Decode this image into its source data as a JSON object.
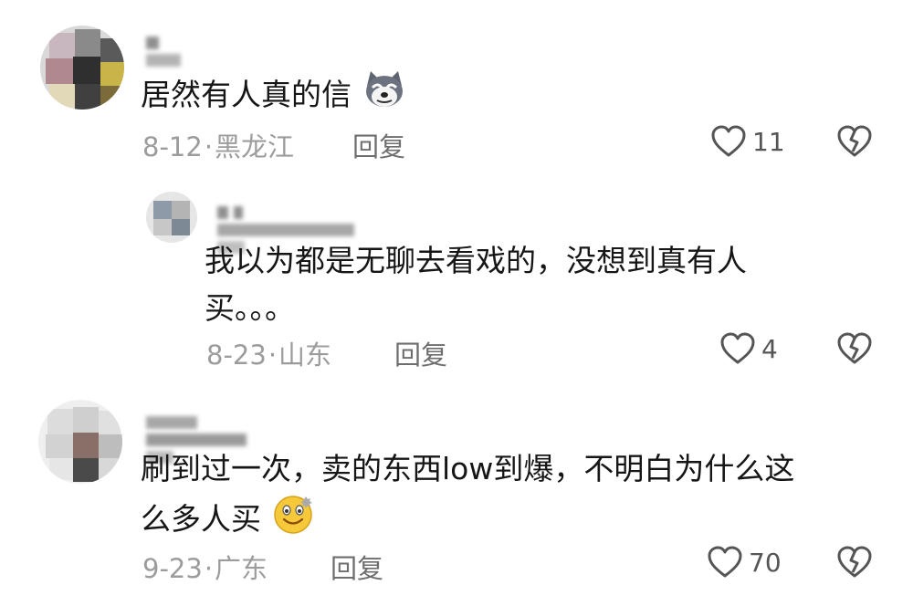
{
  "comments": [
    {
      "text": "居然有人真的信",
      "emoji": "husky-emoji",
      "date": "8-12",
      "dot": "·",
      "location": "黑龙江",
      "reply_label": "回复",
      "likes": "11"
    },
    {
      "text_line1": "我以为都是无聊去看戏的，没想到真有人",
      "text_line2": "买。。。",
      "date": "8-23",
      "dot": "·",
      "location": "山东",
      "reply_label": "回复",
      "likes": "4"
    },
    {
      "text_line1": "刷到过一次，卖的东西low到爆，不明白为什么这",
      "text_line2": "么多人买",
      "emoji": "dizzy-smile-emoji",
      "date": "9-23",
      "dot": "·",
      "location": "广东",
      "reply_label": "回复",
      "likes": "70"
    }
  ],
  "colors": {
    "text": "#161616",
    "meta": "#9c9c9c",
    "reply": "#6e6e6e",
    "icon": "#555555"
  }
}
